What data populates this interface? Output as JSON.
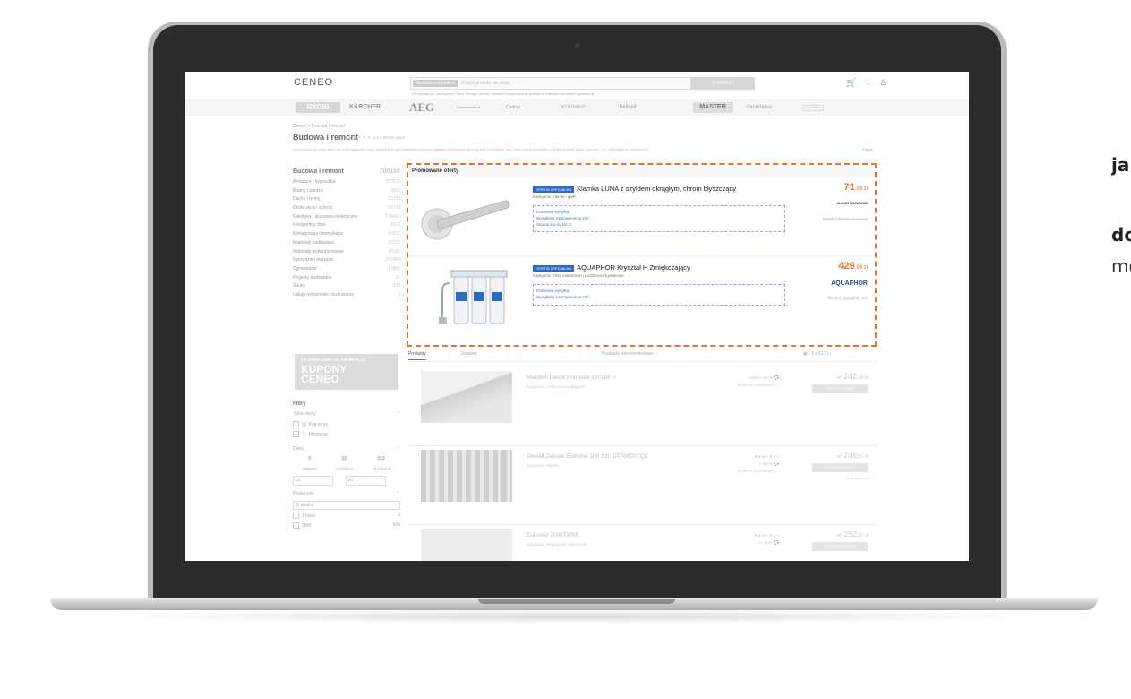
{
  "side_text": {
    "line1": "jak",
    "line2": "do",
    "line3": "mo"
  },
  "header": {
    "logo": "CENEO",
    "search_chip": "Budowa i remont ✕",
    "search_placeholder": "Znajdź produkt lub sklep",
    "search_button": "Q  SZUKAJ",
    "sublinks": "Klimatyzatory i wentylatory   Piece   Pompy   Kominy   Grzejniki   Oczyszczacze powietrza   Warsztat   pomiarie   Ogrzewanie"
  },
  "brands": [
    "RYOBI",
    "KÄRCHER",
    "AEG",
    "lazienkaplus.pl",
    "Cedrus",
    "KT/LOWEO",
    "bellavit",
    "MASTER",
    "castorama",
    "Leroy Merlin"
  ],
  "breadcrumb": "Ceneo  >  Budowa i remont",
  "page": {
    "title": "Budowa i remont",
    "rating": "4.6 z 89246 opinii",
    "description": "Dla budujących nowy dom lub remontujących swoje mieszkanie zgromadziliśmy jeszcze kilkaset potrzebnych do tego celu produktów. Na Ceneo przez wyrobisko z bliska możesz kupić wszystko - od materiałów budowlanych i",
    "more_link": "Więcej"
  },
  "categories": [
    {
      "label": "Budowa i remont",
      "count": "708160"
    },
    {
      "label": "Armatura i hydraulika",
      "count": "207528"
    },
    {
      "label": "Bramy i garaże",
      "count": "5859"
    },
    {
      "label": "Dachy i rynny",
      "count": "15253"
    },
    {
      "label": "Drzwi okna i schody",
      "count": "52273"
    },
    {
      "label": "Elektryka i akcesoria elektryczne",
      "count": "108490"
    },
    {
      "label": "Inteligentny dom",
      "count": "2473"
    },
    {
      "label": "Klimatyzacja i wentylacja",
      "count": "46652"
    },
    {
      "label": "Materiały budowlane",
      "count": "35228"
    },
    {
      "label": "Materiały wykończeniowe",
      "count": "18130"
    },
    {
      "label": "Narzędzia i warsztat",
      "count": "207484"
    },
    {
      "label": "Ogrzewanie",
      "count": "17805"
    },
    {
      "label": "Projekty budowlane",
      "count": "21"
    },
    {
      "label": "Sauny",
      "count": "322"
    },
    {
      "label": "Usługi remontowe i budowlane",
      "count": "1"
    }
  ],
  "banner": {
    "line1": "USTRZEL SWOJĄ PROMOCJĘ",
    "line2": "KUPONY",
    "line3": "CENEO"
  },
  "filters": {
    "title": "Filtry",
    "only_offers": "Tylko oferty",
    "buy_now": "Kup teraz",
    "promotions": "Promocje",
    "price": "Cena",
    "price_levels": [
      "$",
      "$$",
      "$$$"
    ],
    "price_ranges": [
      "Najtaniej",
      "od 5045 zł",
      "od 13113 zł"
    ],
    "from": "od",
    "to": "do",
    "producer": "Producent",
    "search": "Q  Szukaj",
    "producers": [
      {
        "label": "1 base",
        "count": "9"
      },
      {
        "label": "2BM",
        "count": "569"
      }
    ]
  },
  "promoted": {
    "header": "Promowane oferty",
    "offers": [
      {
        "badge": "OFERTA SPECJALNA",
        "title": "Klamka LUNA z szyldem okrągłym, chrom błyszczący",
        "category": "Kategoria: Klamki i gałki",
        "features": [
          "Darmowa wysyłka",
          "Wysyłamy zamówienie w 24h",
          "Gwarancja na lat: 5"
        ],
        "price_int": "71",
        "price_dec": ",99 zł",
        "shop_logo": "KLAMKI DRZWIOWE",
        "shop": "Oferta z klamki-drzwiowe"
      },
      {
        "badge": "OFERTA SPECJALNA",
        "title": "AQUAPHOR Kryształ H Zmiękczający",
        "category": "Kategoria: Filtry nakranowe i podzlewozmywakowe",
        "features": [
          "Darmowa wysyłka",
          "Wysyłamy zamówienie w 24h"
        ],
        "price_int": "429",
        "price_dec": ",99 zł",
        "shop_logo": "AQUAPHOR",
        "shop": "Oferta z aquaphor.com"
      }
    ]
  },
  "tabs": {
    "products": "Produkty",
    "sets": "Zestawy",
    "sort": "Produkty rekomendowane ⌵",
    "pager": "‹  1 z 5171  ›"
  },
  "products": [
    {
      "name": "Mardom Decor Premium Q/015P >",
      "category": "Kategoria: Listwy przypodłogowe",
      "reviews": "Napisz opinię",
      "fav": "Dodaj do ulubionych",
      "price_int": "242",
      "price_dec": ",09 zł",
      "prefix": "od",
      "cta": "IDŹ DO SKLEPU",
      "sub": ""
    },
    {
      "name": "Dewalt Zestaw Extreme 100 Szt. DT70620TQZ",
      "category": "Kategoria: Wiertła",
      "reviews": "1 opinia",
      "fav": "Dodaj do ulubionych",
      "price_int": "249",
      "price_dec": ",00 zł",
      "prefix": "od",
      "cta": "PORÓWNAJ CENY",
      "sub": "w 6 sklepach",
      "rating": "4.5"
    },
    {
      "name": "Euroster 2006TXRX",
      "category": "Kategoria: Regulatory i sterowniki",
      "reviews": "21 opinii",
      "fav": "Dodaj do ulubionych",
      "price_int": "252",
      "price_dec": ",00 zł",
      "prefix": "od",
      "cta": "PORÓWNAJ CENY",
      "sub": "",
      "rating": "4.6"
    }
  ]
}
